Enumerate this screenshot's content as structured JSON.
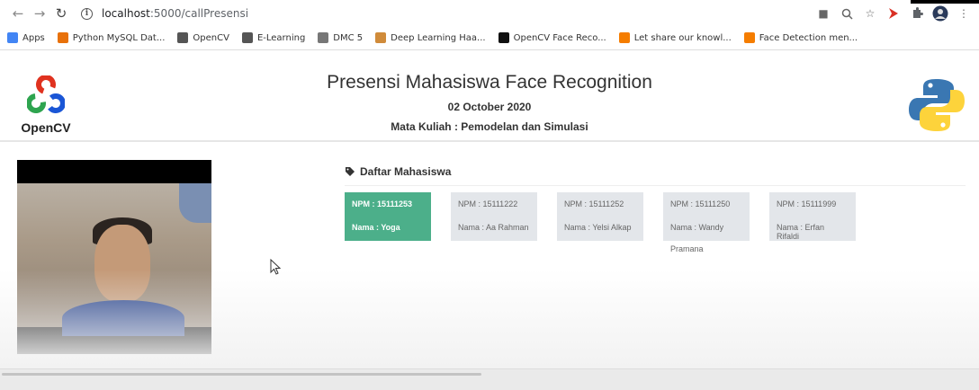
{
  "browser": {
    "url_host": "localhost",
    "url_rest": ":5000/callPresensi",
    "bookmarks": [
      {
        "label": "Apps",
        "color": "#4285f4"
      },
      {
        "label": "Python MySQL Dat...",
        "color": "#e8710a"
      },
      {
        "label": "OpenCV",
        "color": "#555555"
      },
      {
        "label": "E-Learning",
        "color": "#555555"
      },
      {
        "label": "DMC 5",
        "color": "#777777"
      },
      {
        "label": "Deep Learning Haa...",
        "color": "#d08b3a"
      },
      {
        "label": "OpenCV Face Reco...",
        "color": "#111111"
      },
      {
        "label": "Let share our knowl...",
        "color": "#f57d00"
      },
      {
        "label": "Face Detection men...",
        "color": "#f57d00"
      }
    ]
  },
  "header": {
    "left_logo_text": "OpenCV",
    "title": "Presensi Mahasiswa Face Recognition",
    "date": "02 October 2020",
    "course": "Mata Kuliah : Pemodelan dan Simulasi"
  },
  "students": {
    "heading": "Daftar Mahasiswa",
    "items": [
      {
        "npm": "NPM : 15111253",
        "nama": "Nama : Yoga",
        "extra": "",
        "active": true
      },
      {
        "npm": "NPM : 15111222",
        "nama": "Nama : Aa Rahman",
        "extra": "",
        "active": false
      },
      {
        "npm": "NPM : 15111252",
        "nama": "Nama : Yelsi Alkap",
        "extra": "",
        "active": false
      },
      {
        "npm": "NPM : 15111250",
        "nama": "Nama : Wandy",
        "extra": "Pramana",
        "active": false
      },
      {
        "npm": "NPM : 15111999",
        "nama": "Nama : Erfan Rifaldi",
        "extra": "",
        "active": false
      }
    ]
  },
  "colors": {
    "active_card": "#4caf8a",
    "inactive_card": "#e3e6ea"
  }
}
